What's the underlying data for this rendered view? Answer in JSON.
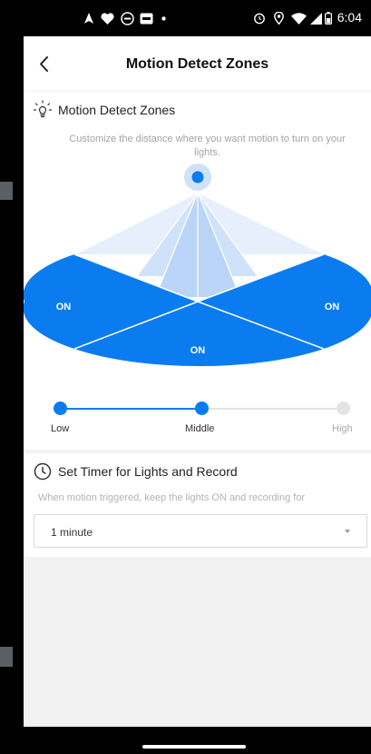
{
  "status_bar": {
    "time": "6:04",
    "left_icons": [
      "navigation-arrow-icon",
      "iheart-icon",
      "adt-icon",
      "ring-icon",
      "dot-icon"
    ],
    "right_icons": [
      "alarm-icon",
      "location-icon",
      "wifi-icon",
      "signal-icon",
      "battery-icon"
    ]
  },
  "header": {
    "title": "Motion Detect Zones",
    "back_icon": "back-chevron-icon"
  },
  "zones": {
    "heading": "Motion Detect Zones",
    "description": "Customize the distance where you want motion to turn on your lights.",
    "zone_labels": {
      "left": "ON",
      "right": "ON",
      "bottom": "ON"
    }
  },
  "sensitivity": {
    "labels": [
      "Low",
      "Middle",
      "High"
    ],
    "selected": "Middle",
    "level": 0.5
  },
  "timer": {
    "heading": "Set Timer for Lights and Record",
    "description": "When motion triggered, keep the lights ON and recording for",
    "selected": "1 minute"
  },
  "colors": {
    "accent": "#0a7cf0",
    "light_cone": "#e6effb",
    "mid_cone": "#cfe2fa",
    "inner_cone": "#bad5f7",
    "inactive": "#e3e3e3"
  }
}
